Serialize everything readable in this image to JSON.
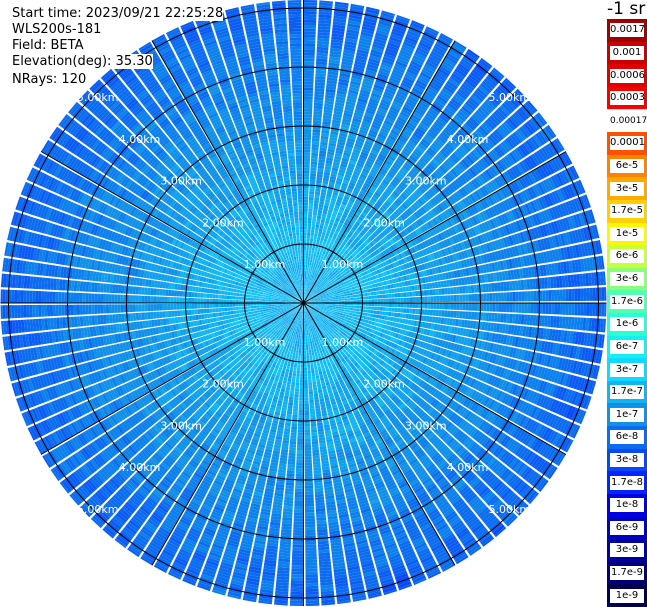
{
  "info": {
    "start_time": "Start time: 2023/09/21 22:25:28",
    "instrument": "WLS200s-181",
    "field": "Field: BETA",
    "elevation": "Elevation(deg): 35.30",
    "nrays": "NRays: 120"
  },
  "colorbar": {
    "unit": "-1 sr",
    "labels": [
      "0.0017",
      "0.001",
      "0.0006",
      "0.0003",
      "0.00017",
      "0.0001",
      "6e-5",
      "3e-5",
      "1.7e-5",
      "1e-5",
      "6e-6",
      "3e-6",
      "1.7e-6",
      "1e-6",
      "6e-7",
      "3e-7",
      "1.7e-7",
      "1e-7",
      "6e-8",
      "3e-8",
      "1.7e-8",
      "1e-8",
      "6e-9",
      "3e-9",
      "1.7e-9",
      "1e-9"
    ],
    "colors": [
      "#a00000",
      "#c80000",
      "#e10000",
      "#f80000",
      "#ffffff",
      "#ff5000",
      "#ff8200",
      "#ffa800",
      "#ffd000",
      "#f8f800",
      "#c8ff3c",
      "#8cff78",
      "#50ffb4",
      "#28ffd2",
      "#14f0f0",
      "#10d8ff",
      "#10b4f0",
      "#1090e8",
      "#0c6cf0",
      "#0848f8",
      "#0424ff",
      "#0000e0",
      "#0000c0",
      "#0000a0",
      "#000078",
      "#000050"
    ]
  },
  "chart_data": {
    "type": "heatmap",
    "subtype": "polar-ppi",
    "field": "BETA",
    "unit": "-1 sr",
    "n_rays": 120,
    "elevation_deg": 35.3,
    "range_rings_km": [
      1.0,
      2.0,
      3.0,
      4.0,
      5.0
    ],
    "ring_labels": [
      "1.00km",
      "2.00km",
      "3.00km",
      "4.00km",
      "5.00km"
    ],
    "max_range_km": 5.0,
    "azimuth_spokes_deg": [
      0,
      30,
      60,
      90,
      120,
      150,
      180,
      210,
      240,
      270,
      300,
      330
    ],
    "value_profile_by_range": [
      {
        "range_km": 0.5,
        "typical": "1.7e-7"
      },
      {
        "range_km": 1.0,
        "typical": "3e-7"
      },
      {
        "range_km": 2.0,
        "typical": "1.7e-7"
      },
      {
        "range_km": 3.0,
        "typical": "1e-7"
      },
      {
        "range_km": 4.0,
        "typical": "6e-8"
      },
      {
        "range_km": 5.0,
        "typical": "3e-8"
      }
    ]
  }
}
